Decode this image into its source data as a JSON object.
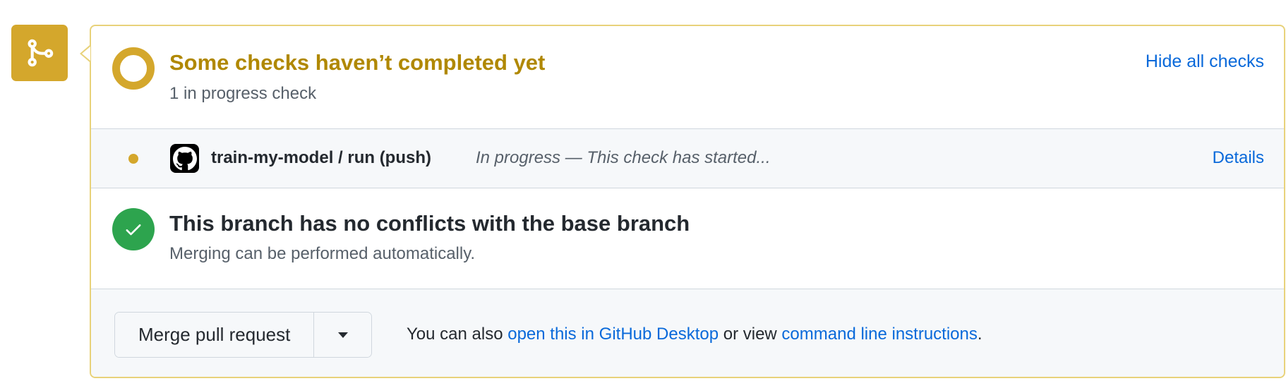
{
  "merge_box": {
    "icon": "git-merge-icon",
    "accent_color": "#d4a72c"
  },
  "checks": {
    "title": "Some checks haven’t completed yet",
    "subtitle": "1 in progress check",
    "toggle_label": "Hide all checks",
    "status_icon": "pending-ring-icon",
    "items": [
      {
        "avatar_icon": "github-octocat-icon",
        "name": "train-my-model / run (push)",
        "status": "In progress — This check has started...",
        "details_label": "Details",
        "status_color": "#d4a72c"
      }
    ]
  },
  "conflicts": {
    "title": "This branch has no conflicts with the base branch",
    "subtitle": "Merging can be performed automatically.",
    "status_icon": "check-icon",
    "status_color": "#2da44e"
  },
  "merge": {
    "button_label": "Merge pull request",
    "dropdown_icon": "triangle-down-icon",
    "help_prefix": "You can also ",
    "desktop_link": "open this in GitHub Desktop",
    "help_middle": " or view ",
    "cli_link": "command line instructions",
    "help_suffix": "."
  }
}
